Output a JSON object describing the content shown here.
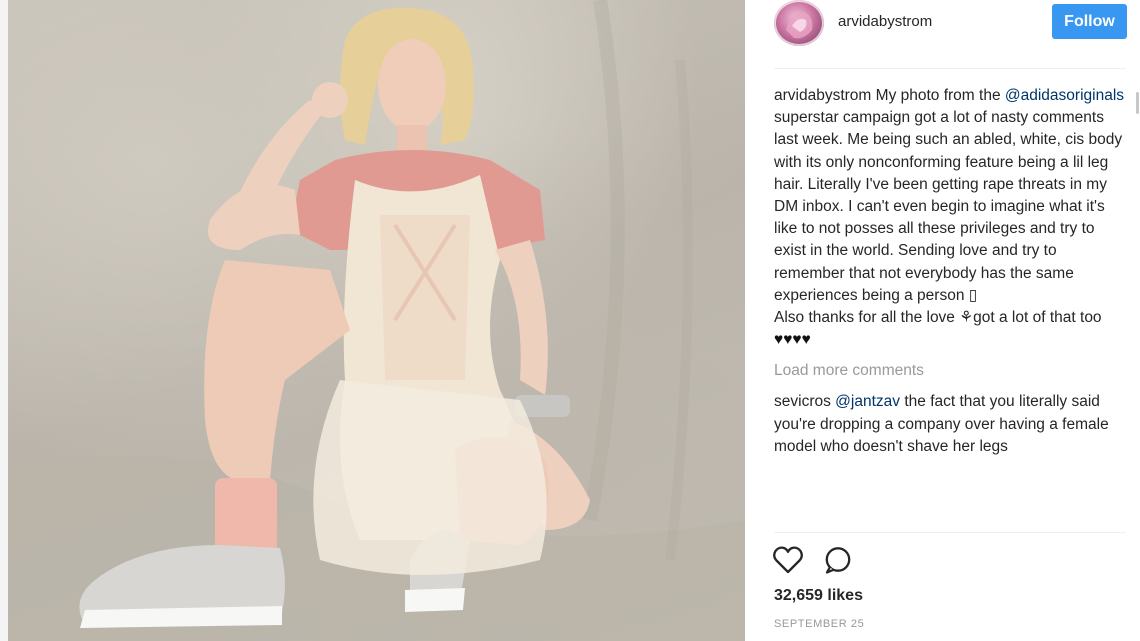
{
  "photo": {
    "alt_name": "post-photo"
  },
  "header": {
    "username": "arvidabystrom",
    "follow_label": "Follow",
    "avatar_icon": "profile-avatar"
  },
  "caption": {
    "username": "arvidabystrom",
    "text_before_mention": "My photo from the ",
    "mention": "@adidasoriginals",
    "text_after_mention": " superstar campaign got a lot of nasty comments last week. Me being such an abled, white, cis body with its only nonconforming feature being a lil leg hair. Literally I've been getting rape threats in my DM inbox. I can't even begin to imagine what it's like to not posses all these privileges and try to exist in the world. Sending love and try to remember that not everybody has the same experiences being a person ",
    "glyph_box": "▯",
    "line2": "Also thanks for all the love ",
    "plant_glyph": "⚘",
    "line2_after": "got a lot of that too ",
    "hearts": "♥♥♥♥"
  },
  "load_more_label": "Load more comments",
  "comment": {
    "username": "sevicros",
    "mention": "@jantzav",
    "text": " the fact that you literally said you're dropping a company over having a female model who doesn't shave her legs"
  },
  "actions": {
    "like_icon": "heart-outline-icon",
    "comment_icon": "speech-bubble-icon"
  },
  "likes_text": "32,659 likes",
  "date_text": "SEPTEMBER 25",
  "colors": {
    "follow_button": "#3897f0",
    "mention": "#003569",
    "muted": "#999999",
    "text": "#262626"
  }
}
